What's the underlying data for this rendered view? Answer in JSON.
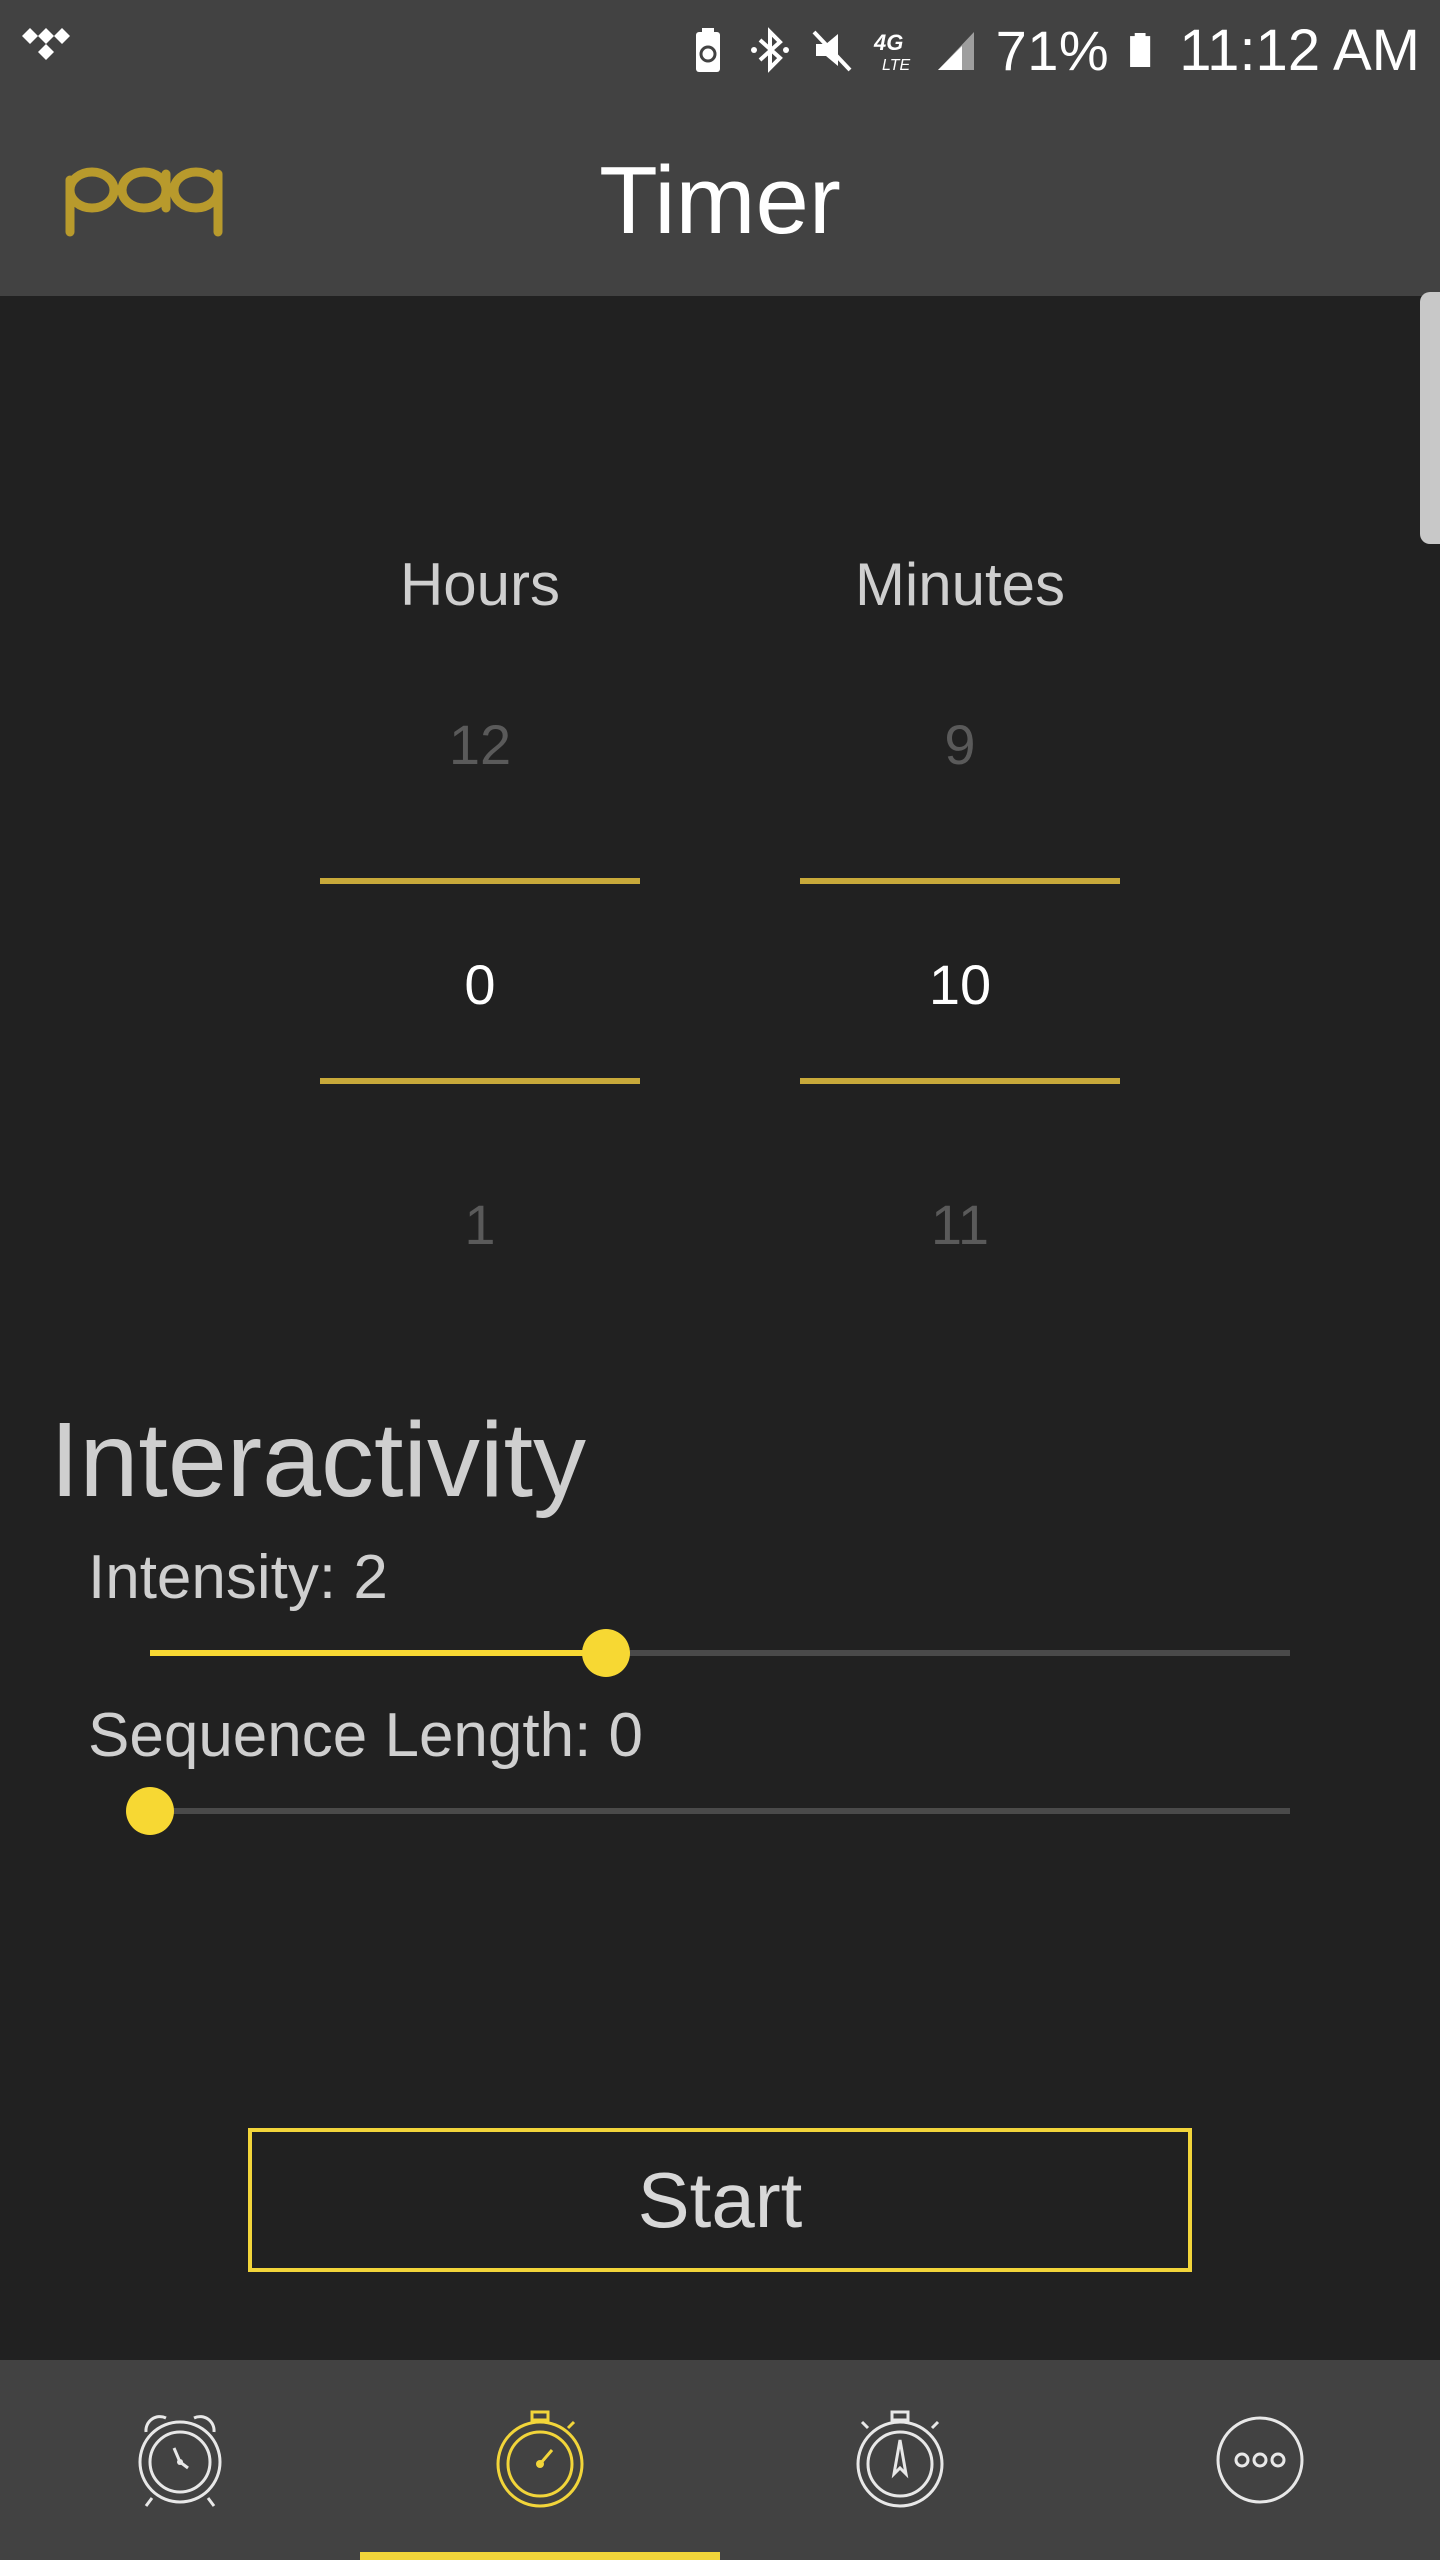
{
  "status_bar": {
    "battery_percent": "71%",
    "time": "11:12 AM",
    "network": "4G LTE",
    "icons": [
      "tidal-icon",
      "battery-saver-icon",
      "bluetooth-icon",
      "mute-icon",
      "lte-icon",
      "signal-icon",
      "battery-icon"
    ]
  },
  "app_bar": {
    "logo_text": "paq",
    "title": "Timer"
  },
  "timer_picker": {
    "hours": {
      "label": "Hours",
      "prev": "12",
      "selected": "0",
      "next": "1"
    },
    "minutes": {
      "label": "Minutes",
      "prev": "9",
      "selected": "10",
      "next": "11"
    }
  },
  "interactivity": {
    "title": "Interactivity",
    "intensity": {
      "label": "Intensity: 2",
      "value_fraction": 0.4
    },
    "sequence_length": {
      "label": "Sequence Length: 0",
      "value_fraction": 0.0
    }
  },
  "start_button": {
    "label": "Start"
  },
  "bottom_nav": {
    "items": [
      {
        "icon": "alarm-clock-icon",
        "active": false
      },
      {
        "icon": "stopwatch-timer-icon",
        "active": true
      },
      {
        "icon": "stopwatch-compass-icon",
        "active": false
      },
      {
        "icon": "more-icon",
        "active": false
      }
    ]
  },
  "colors": {
    "accent": "#f2d53a",
    "background": "#212121",
    "bar": "#424242"
  }
}
